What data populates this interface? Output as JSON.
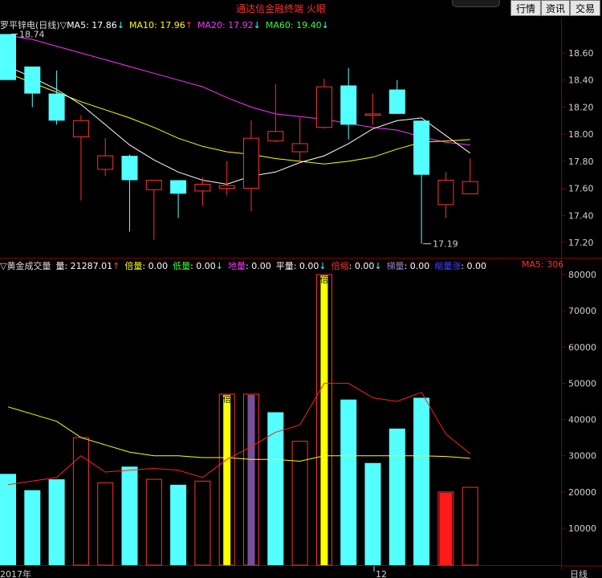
{
  "app": {
    "title": "通达信金融终端  火眼"
  },
  "buttons": [
    {
      "label": "行情"
    },
    {
      "label": "资讯"
    },
    {
      "label": "交易"
    }
  ],
  "price_panel": {
    "stock_label": "罗平锌电(日线)",
    "ma": [
      {
        "name": "MA5",
        "value": "17.86",
        "arrow": "↓",
        "color": "#ffffff"
      },
      {
        "name": "MA10",
        "value": "17.96",
        "arrow": "↑",
        "color": "#ffff00"
      },
      {
        "name": "MA20",
        "value": "17.92",
        "arrow": "↓",
        "color": "#ff33ff"
      },
      {
        "name": "MA60",
        "value": "19.40",
        "arrow": "↓",
        "color": "#33ff33"
      }
    ],
    "high_marker": "18.74",
    "low_marker": "17.19",
    "y_ticks": [
      "18.60",
      "18.40",
      "18.20",
      "18.00",
      "17.80",
      "17.60",
      "17.40",
      "17.20"
    ]
  },
  "volume_panel": {
    "label": "黄金成交量",
    "items": [
      {
        "name": "量",
        "value": "21287.01",
        "arrow": "↑",
        "color": "#ffffff",
        "arrow_color": "#ff4040"
      },
      {
        "name": "倍量",
        "value": "0.00",
        "arrow": "",
        "color": "#ffff00"
      },
      {
        "name": "低量",
        "value": "0.00",
        "arrow": "↓",
        "color": "#33ff33",
        "arrow_color": "#40ffff"
      },
      {
        "name": "地量",
        "value": "0.00",
        "arrow": "",
        "color": "#ff33ff"
      },
      {
        "name": "平量",
        "value": "0.00",
        "arrow": "↓",
        "color": "#ffffff",
        "arrow_color": "#40ffff"
      },
      {
        "name": "倍缩",
        "value": "0.00",
        "arrow": "↓",
        "color": "#ff3030",
        "arrow_color": "#40ffff"
      },
      {
        "name": "梯量",
        "value": "0.00",
        "arrow": "",
        "color": "#9a7fc0"
      },
      {
        "name": "缩量涨",
        "value": "0.00",
        "arrow": "",
        "color": "#4040ff"
      }
    ],
    "ma5_label": "MA5: 306",
    "y_ticks": [
      "80000",
      "70000",
      "60000",
      "50000",
      "40000",
      "30000",
      "20000",
      "10000"
    ],
    "bar_marks": [
      {
        "text": "倍"
      },
      {
        "text": "倍"
      }
    ]
  },
  "x_axis": {
    "labels": [
      "2017年",
      "12"
    ],
    "period": "日线"
  },
  "colors": {
    "up": "#ff3030",
    "down": "#54ffff",
    "ma5": "#ffffff",
    "ma10": "#ffff00",
    "ma20": "#ff33ff",
    "grid": "#8b0000"
  },
  "chart_data": [
    {
      "type": "candlestick",
      "ylim": [
        17.1,
        18.8
      ],
      "candles": [
        {
          "open": 18.74,
          "close": 18.4,
          "high": 18.74,
          "low": 18.4
        },
        {
          "open": 18.5,
          "close": 18.3,
          "high": 18.5,
          "low": 18.2
        },
        {
          "open": 18.3,
          "close": 18.1,
          "high": 18.47,
          "low": 18.07
        },
        {
          "open": 17.98,
          "close": 18.1,
          "high": 18.14,
          "low": 17.51
        },
        {
          "open": 17.74,
          "close": 17.84,
          "high": 17.97,
          "low": 17.69
        },
        {
          "open": 17.84,
          "close": 17.66,
          "high": 17.85,
          "low": 17.28
        },
        {
          "open": 17.59,
          "close": 17.66,
          "high": 17.66,
          "low": 17.22
        },
        {
          "open": 17.66,
          "close": 17.56,
          "high": 17.66,
          "low": 17.38
        },
        {
          "open": 17.58,
          "close": 17.63,
          "high": 17.68,
          "low": 17.47
        },
        {
          "open": 17.6,
          "close": 17.62,
          "high": 17.8,
          "low": 17.55
        },
        {
          "open": 17.6,
          "close": 17.97,
          "high": 18.1,
          "low": 17.43
        },
        {
          "open": 17.95,
          "close": 18.02,
          "high": 18.37,
          "low": 17.94
        },
        {
          "open": 17.87,
          "close": 17.93,
          "high": 18.12,
          "low": 17.79
        },
        {
          "open": 18.05,
          "close": 18.35,
          "high": 18.41,
          "low": 18.04
        },
        {
          "open": 18.36,
          "close": 18.07,
          "high": 18.49,
          "low": 17.96
        },
        {
          "open": 18.14,
          "close": 18.15,
          "high": 18.3,
          "low": 18.07
        },
        {
          "open": 18.33,
          "close": 18.15,
          "high": 18.4,
          "low": 18.15
        },
        {
          "open": 18.1,
          "close": 17.7,
          "high": 18.1,
          "low": 17.19
        },
        {
          "open": 17.48,
          "close": 17.66,
          "high": 17.72,
          "low": 17.38
        },
        {
          "open": 17.56,
          "close": 17.65,
          "high": 17.82,
          "low": 17.56
        }
      ],
      "ma5": [
        18.5,
        18.42,
        18.33,
        18.22,
        18.07,
        17.92,
        17.81,
        17.72,
        17.66,
        17.63,
        17.69,
        17.72,
        17.79,
        17.84,
        17.93,
        18.04,
        18.1,
        18.12,
        17.99,
        17.86
      ],
      "ma10": [
        18.45,
        18.38,
        18.31,
        18.24,
        18.18,
        18.12,
        18.05,
        17.97,
        17.91,
        17.87,
        17.85,
        17.82,
        17.8,
        17.78,
        17.8,
        17.83,
        17.89,
        17.94,
        17.95,
        17.96
      ],
      "ma20": [
        18.73,
        18.7,
        18.65,
        18.6,
        18.55,
        18.5,
        18.45,
        18.4,
        18.35,
        18.27,
        18.2,
        18.15,
        18.13,
        18.11,
        18.08,
        18.05,
        18.03,
        17.98,
        17.94,
        17.92
      ]
    },
    {
      "type": "bar",
      "ylim": [
        0,
        82000
      ],
      "bars": [
        {
          "value": 25000,
          "kind": "down"
        },
        {
          "value": 20500,
          "kind": "down"
        },
        {
          "value": 23500,
          "kind": "down"
        },
        {
          "value": 35000,
          "kind": "up"
        },
        {
          "value": 22500,
          "kind": "up"
        },
        {
          "value": 27000,
          "kind": "down"
        },
        {
          "value": 23500,
          "kind": "up"
        },
        {
          "value": 22000,
          "kind": "down"
        },
        {
          "value": 23000,
          "kind": "up"
        },
        {
          "value": 47000,
          "kind": "up",
          "highlight": "yellow"
        },
        {
          "value": 47000,
          "kind": "up",
          "highlight": "purple"
        },
        {
          "value": 42000,
          "kind": "down"
        },
        {
          "value": 34000,
          "kind": "up"
        },
        {
          "value": 80000,
          "kind": "up",
          "highlight": "yellow"
        },
        {
          "value": 45500,
          "kind": "down"
        },
        {
          "value": 28000,
          "kind": "down"
        },
        {
          "value": 37500,
          "kind": "down"
        },
        {
          "value": 46000,
          "kind": "down"
        },
        {
          "value": 20000,
          "kind": "up",
          "highlight": "red"
        },
        {
          "value": 21287,
          "kind": "up"
        }
      ],
      "ma5": [
        22000,
        23000,
        24000,
        30000,
        25500,
        26000,
        26500,
        26000,
        24000,
        29000,
        32500,
        36500,
        38500,
        50000,
        50000,
        46000,
        45000,
        47500,
        36000,
        30600
      ],
      "ma_long": [
        43500,
        41500,
        39500,
        35000,
        33000,
        31000,
        30000,
        30000,
        29500,
        29500,
        29000,
        29000,
        28500,
        30000,
        30000,
        30000,
        30000,
        30000,
        29800,
        29300
      ]
    }
  ]
}
